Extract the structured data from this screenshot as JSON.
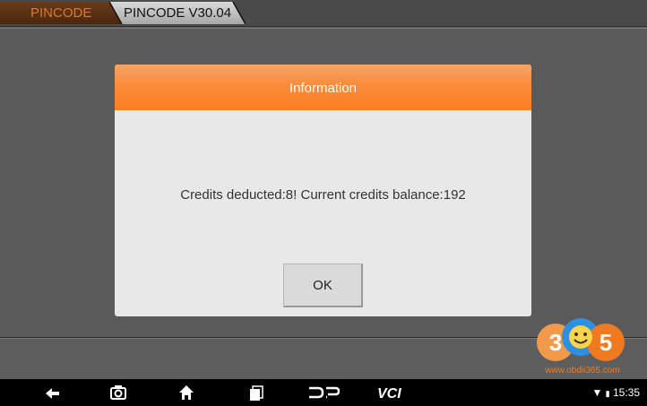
{
  "breadcrumb": {
    "items": [
      {
        "label": "PINCODE"
      },
      {
        "label": "PINCODE V30.04"
      }
    ]
  },
  "dialog": {
    "title": "Information",
    "message": "Credits deducted:8! Current credits balance:192",
    "ok_label": "OK"
  },
  "watermark": {
    "logo_text": "365",
    "url": "www.obdii365.com"
  },
  "navbar": {
    "icons": [
      "back-icon",
      "camera-icon",
      "home-icon",
      "recent-apps-icon",
      "dp-icon",
      "vci-icon"
    ],
    "dp_label": "DP",
    "vci_label": "VCI"
  },
  "status": {
    "time": "15:35",
    "icons": [
      "wifi-icon",
      "battery-icon"
    ]
  },
  "colors": {
    "accent": "#fd7d22",
    "header_light": "#f4a565",
    "panel": "#5a5a5a",
    "dialog_bg": "#e8e8e8"
  }
}
